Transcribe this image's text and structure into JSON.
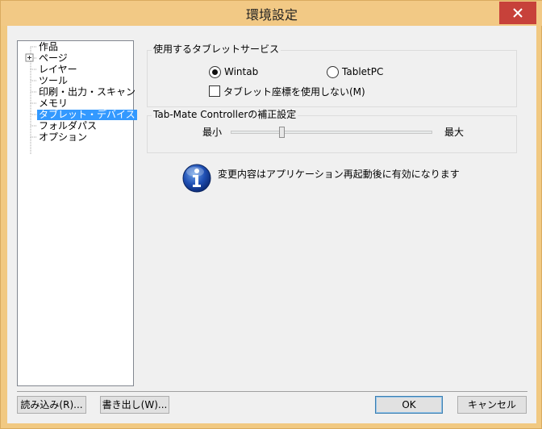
{
  "window": {
    "title": "環境設定"
  },
  "tree": {
    "items": [
      "作品",
      "ページ",
      "レイヤー",
      "ツール",
      "印刷・出力・スキャン",
      "メモリ",
      "タブレット・デバイス",
      "フォルダパス",
      "オプション"
    ],
    "selected_index": 6,
    "expander": "+"
  },
  "tablet_service": {
    "label": "使用するタブレットサービス",
    "options": [
      "Wintab",
      "TabletPC"
    ],
    "selected": "Wintab",
    "checkbox_label": "タブレット座標を使用しない(M)",
    "checkbox_checked": false
  },
  "tabmate": {
    "label": "Tab-Mate Controllerの補正設定",
    "min_label": "最小",
    "max_label": "最大",
    "slider_fraction": 0.25
  },
  "notice": {
    "text": "変更内容はアプリケーション再起動後に有効になります",
    "icon": "info-icon"
  },
  "buttons": {
    "import": "読み込み(R)...",
    "export": "書き出し(W)...",
    "ok": "OK",
    "cancel": "キャンセル"
  },
  "colors": {
    "title_bar": "#f2c985",
    "close": "#c7413a",
    "selection": "#3399ff"
  }
}
